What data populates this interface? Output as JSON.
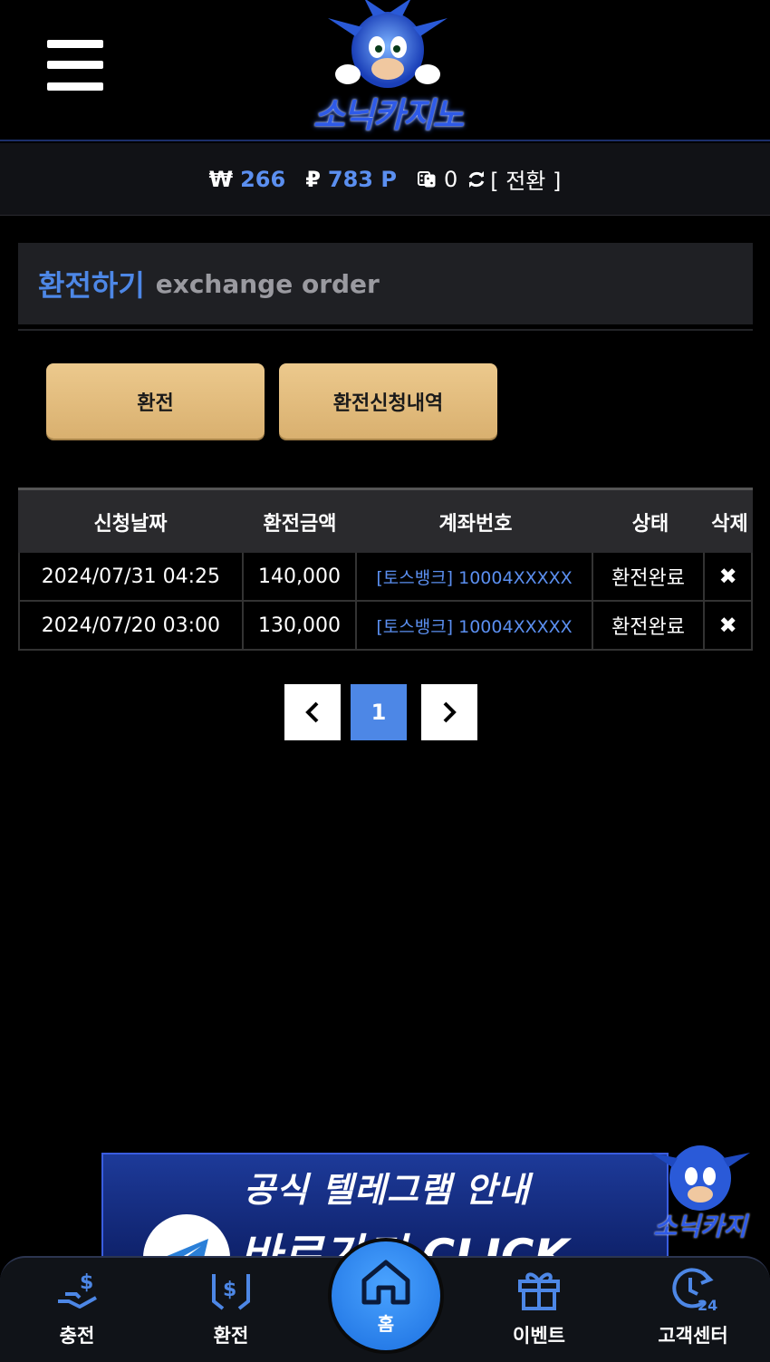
{
  "header": {
    "logo_text": "소닉카지노"
  },
  "balance": {
    "won_symbol": "₩",
    "won_value": "266",
    "point_symbol": "₽",
    "point_value": "783 P",
    "dice_value": "0",
    "convert_label": "[ 전환 ]"
  },
  "section": {
    "title_kr": "환전하기",
    "title_en": "exchange order"
  },
  "buttons": {
    "exchange": "환전",
    "history": "환전신청내역"
  },
  "table": {
    "headers": [
      "신청날짜",
      "환전금액",
      "계좌번호",
      "상태",
      "삭제"
    ],
    "rows": [
      {
        "date": "2024/07/31 04:25",
        "amount": "140,000",
        "account": "[토스뱅크] 10004XXXXX",
        "status": "환전완료"
      },
      {
        "date": "2024/07/20 03:00",
        "amount": "130,000",
        "account": "[토스뱅크] 10004XXXXX",
        "status": "환전완료"
      }
    ]
  },
  "pagination": {
    "current": "1"
  },
  "banner": {
    "title": "공식 텔레그램 안내",
    "subtitle": "바로가기 CLICK",
    "mascot_text": "소닉카지"
  },
  "nav": {
    "charge": "충전",
    "exchange": "환전",
    "home": "홈",
    "event": "이벤트",
    "support": "고객센터"
  },
  "colors": {
    "accent_blue": "#4d87e6",
    "gold": "#e6c083"
  }
}
